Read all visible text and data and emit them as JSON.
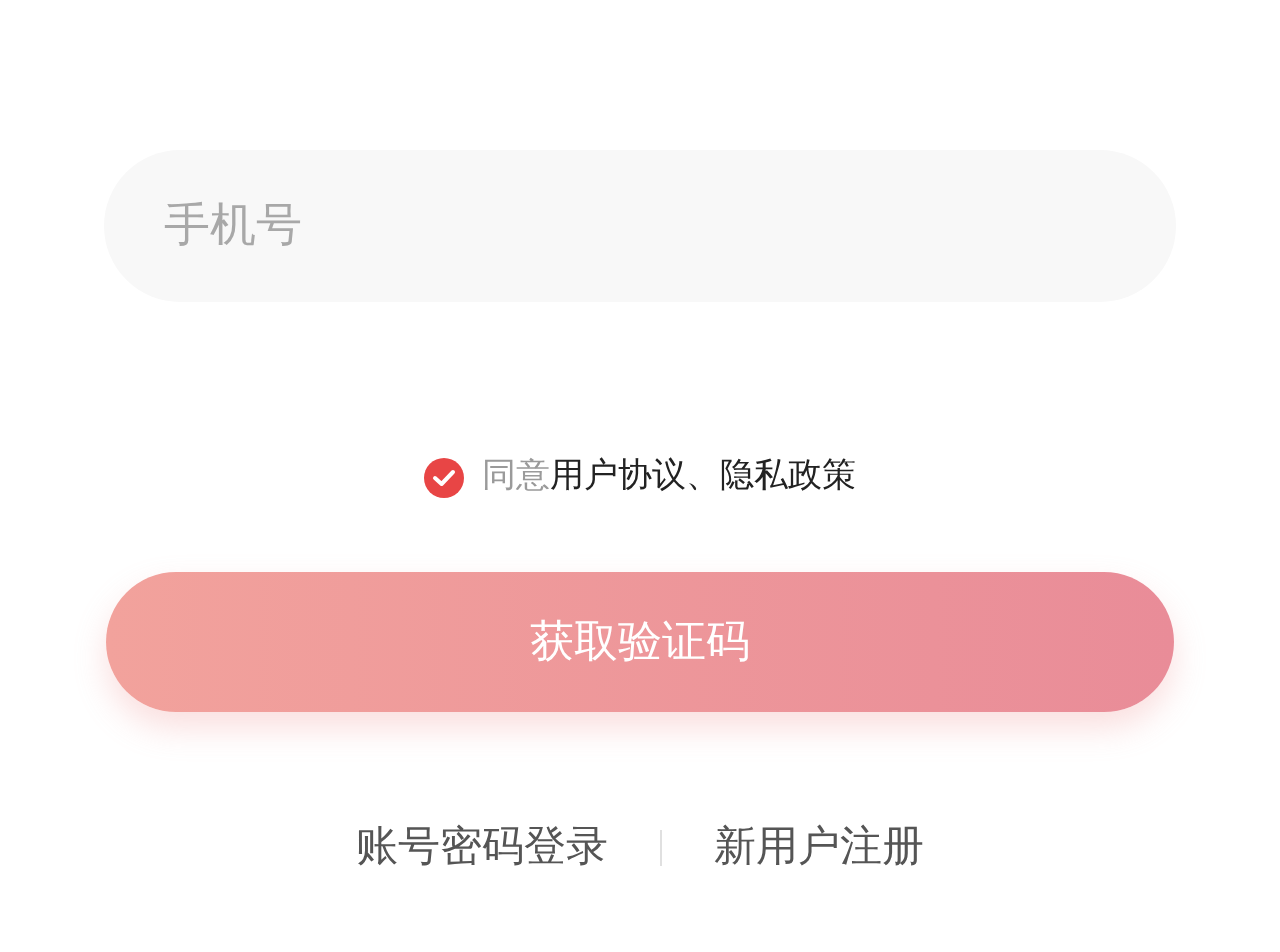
{
  "phone_field": {
    "placeholder": "手机号"
  },
  "agreement": {
    "checked": true,
    "prefix": "同意",
    "links": [
      "用户协议",
      "隐私政策"
    ],
    "separator": "、"
  },
  "submit_button": {
    "label": "获取验证码",
    "disabled": true
  },
  "footer_links": [
    "账号密码登录",
    "新用户注册"
  ]
}
